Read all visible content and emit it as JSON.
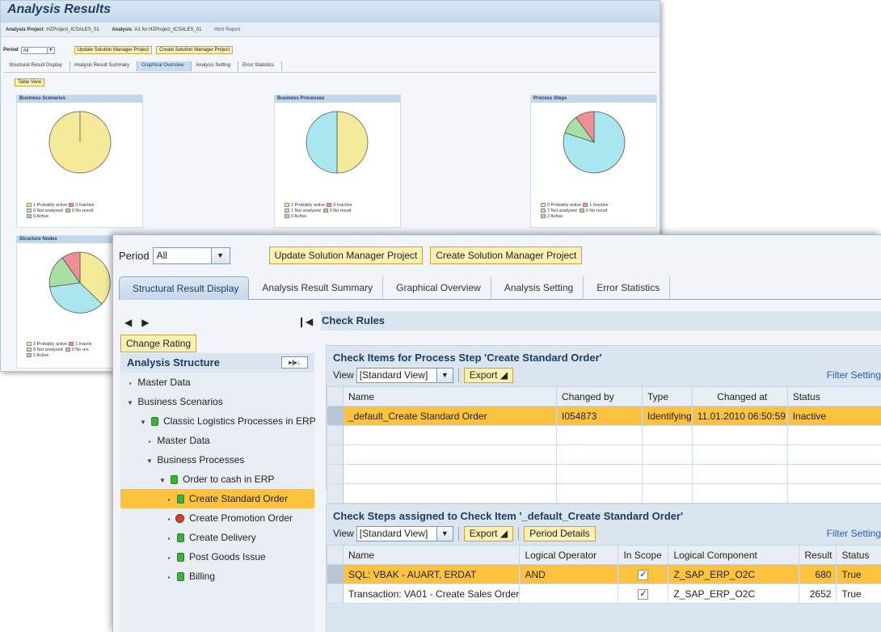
{
  "back": {
    "title": "Analysis Results",
    "project_label": "Analysis Project",
    "project_value": "HZProject_ICSALES_01",
    "analysis_label": "Analysis",
    "analysis_value": "A1 for HZProject_ICSALES_01",
    "html_report": "Html Report",
    "period_label": "Period",
    "period_value": "All",
    "update_btn": "Update Solution Manager Project",
    "create_btn": "Create Solution Manager Project",
    "tabs": [
      "Structural Result Display",
      "Analysis Result Summary",
      "Graphical Overview",
      "Analysis Setting",
      "Error Statistics"
    ],
    "table_view": "Table View",
    "panels": {
      "scenarios": {
        "title": "Business Scenarios",
        "legend": [
          "1 Probably active",
          "0 Inactive",
          "0 Not analysed",
          "0 No result",
          "0 Active"
        ]
      },
      "processes": {
        "title": "Business Processes",
        "legend": [
          "1 Probably active",
          "0 Inactive",
          "1 Not analysed",
          "0 No result",
          "0 Active"
        ]
      },
      "steps": {
        "title": "Process Steps",
        "legend": [
          "0 Probably active",
          "1 Inactive",
          "7 Not analysed",
          "0 No result",
          "2 Active"
        ]
      },
      "nodes": {
        "title": "Structure Nodes",
        "legend": [
          "2 Probably active",
          "1 Inactiv",
          "8 Not analysed",
          "0 No res",
          "2 Active"
        ]
      }
    },
    "colors": {
      "probably_active": "#f5ea9a",
      "inactive": "#ee8f95",
      "not_analysed": "#a9e6f0",
      "no_result": "#f5b766",
      "active": "#a8e0a4"
    }
  },
  "front": {
    "period_label": "Period",
    "period_value": "All",
    "update_btn": "Update Solution Manager Project",
    "create_btn": "Create Solution Manager Project",
    "tabs": [
      "Structural Result Display",
      "Analysis Result Summary",
      "Graphical Overview",
      "Analysis Setting",
      "Error Statistics"
    ],
    "change_rating": "Change Rating",
    "tree": {
      "title": "Analysis Structure",
      "nodes": [
        "Master Data",
        "Business Scenarios",
        "Classic Logistics Processes in ERP",
        "Master Data",
        "Business Processes",
        "Order to cash in ERP",
        "Create Standard Order",
        "Create Promotion Order",
        "Create Delivery",
        "Post Goods Issue",
        "Billing"
      ]
    },
    "check_rules": "Check Rules",
    "items": {
      "title": "Check Items for Process Step 'Create Standard Order'",
      "view_label": "View",
      "view_value": "[Standard View]",
      "export": "Export",
      "filter": "Filter",
      "settings": "Settings",
      "columns": [
        "Name",
        "Changed by",
        "Type",
        "Changed at",
        "Status"
      ],
      "rows": [
        [
          "_default_Create Standard Order",
          "I054873",
          "Identifying",
          "11.01.2010 06:50:59",
          "Inactive"
        ]
      ]
    },
    "steps": {
      "title": "Check Steps assigned to Check Item '_default_Create Standard Order'",
      "view_label": "View",
      "view_value": "[Standard View]",
      "export": "Export",
      "period_details": "Period Details",
      "filter": "Filter",
      "settings": "Settings",
      "columns": [
        "Name",
        "Logical Operator",
        "In Scope",
        "Logical Component",
        "Result",
        "Status"
      ],
      "rows": [
        [
          "SQL: VBAK - AUART, ERDAT",
          "AND",
          "✓",
          "Z_SAP_ERP_O2C",
          "680",
          "True"
        ],
        [
          "Transaction: VA01 - Create Sales Order",
          "",
          "✓",
          "Z_SAP_ERP_O2C",
          "2652",
          "True"
        ]
      ]
    }
  }
}
